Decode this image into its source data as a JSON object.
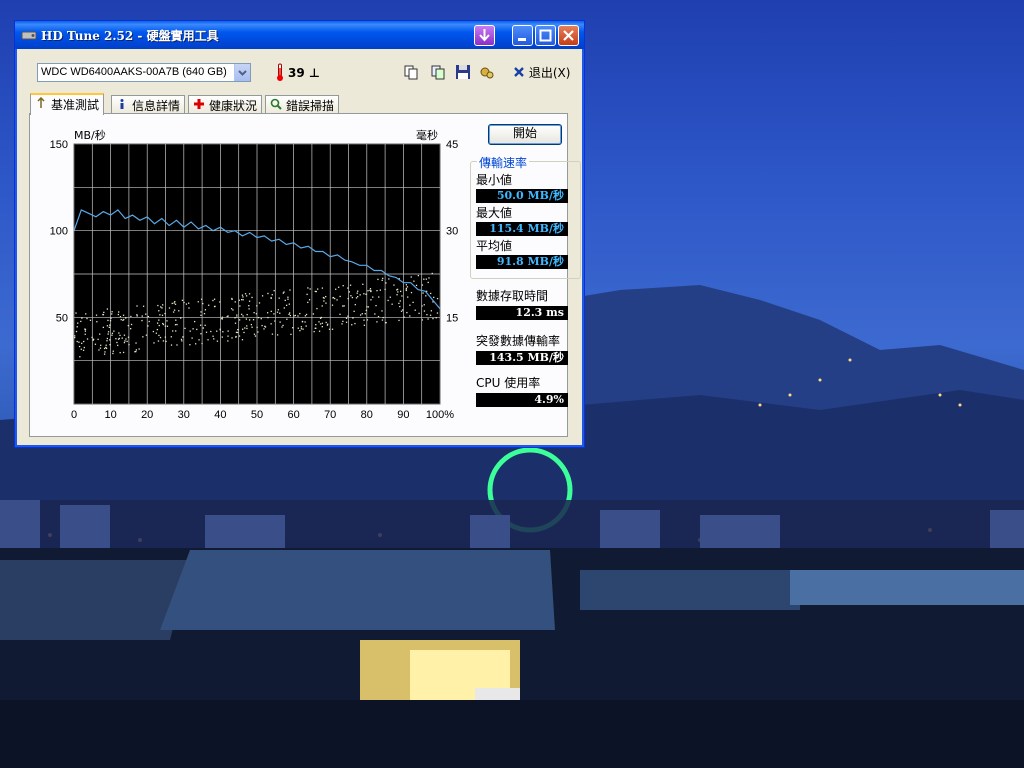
{
  "window": {
    "title": "HD Tune 2.52 - 硬盤實用工具"
  },
  "toolbar": {
    "drive": "WDC WD6400AAKS-00A7B (640 GB)",
    "temperature": "39 ⊥",
    "exit_label": "退出(X)"
  },
  "tabs": [
    {
      "label": "基准測試",
      "icon": "benchmark-icon"
    },
    {
      "label": "信息詳情",
      "icon": "info-icon"
    },
    {
      "label": "健康狀況",
      "icon": "health-icon"
    },
    {
      "label": "錯誤掃描",
      "icon": "scan-icon"
    }
  ],
  "start_button": "開始",
  "stats": {
    "group_title": "傳輸速率",
    "min_label": "最小値",
    "min_value": "50.0 MB/秒",
    "max_label": "最大値",
    "max_value": "115.4 MB/秒",
    "avg_label": "平均値",
    "avg_value": "91.8 MB/秒",
    "access_label": "數據存取時間",
    "access_value": "12.3 ms",
    "burst_label": "突發數據傳輸率",
    "burst_value": "143.5 MB/秒",
    "cpu_label": "CPU 使用率",
    "cpu_value": "4.9%"
  },
  "chart_data": {
    "type": "line",
    "ylabel_left": "MB/秒",
    "ylabel_right": "毫秒",
    "yticks_left": [
      "150",
      "100",
      "50"
    ],
    "yticks_right": [
      "45",
      "30",
      "15"
    ],
    "xticks": [
      "0",
      "10",
      "20",
      "30",
      "40",
      "50",
      "60",
      "70",
      "80",
      "90",
      "100%"
    ],
    "ylim": [
      0,
      150
    ],
    "ylim_right": [
      0,
      45
    ],
    "xlim": [
      0,
      100
    ],
    "grid": true,
    "series": [
      {
        "color": "#5aa8e6",
        "x": [
          0,
          2,
          4,
          6,
          8,
          10,
          12,
          14,
          16,
          18,
          20,
          22,
          24,
          26,
          28,
          30,
          32,
          34,
          36,
          38,
          40,
          42,
          44,
          46,
          48,
          50,
          52,
          54,
          56,
          58,
          60,
          62,
          64,
          66,
          68,
          70,
          72,
          74,
          76,
          78,
          80,
          82,
          84,
          86,
          88,
          90,
          92,
          94,
          96,
          98,
          100
        ],
        "y": [
          100,
          112,
          110,
          108,
          111,
          109,
          112,
          107,
          109,
          106,
          108,
          104,
          107,
          103,
          106,
          102,
          105,
          101,
          103,
          100,
          102,
          99,
          100,
          97,
          99,
          96,
          97,
          94,
          95,
          92,
          93,
          90,
          91,
          88,
          88,
          85,
          86,
          83,
          82,
          80,
          80,
          77,
          77,
          74,
          73,
          70,
          70,
          66,
          65,
          60,
          55
        ]
      },
      {
        "color": "#e6e6c8",
        "axis": "right",
        "x_min": 0,
        "x_max": 100,
        "y_start_min": 8,
        "y_start_max": 16,
        "y_end_min": 15,
        "y_end_max": 23
      }
    ]
  },
  "colors": {
    "titlebar": "#0058ee",
    "plot_bg": "#000000",
    "transfer_line": "#5aa8e6",
    "access_dots": "#e6e6c8",
    "accent_text": "#0046d5"
  }
}
